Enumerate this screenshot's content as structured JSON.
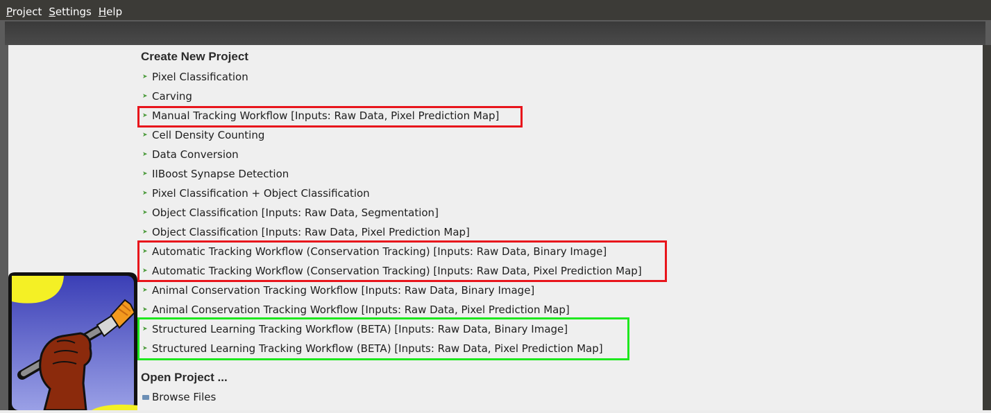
{
  "menu": {
    "items": [
      {
        "mnemonic": "P",
        "rest": "roject"
      },
      {
        "mnemonic": "S",
        "rest": "ettings"
      },
      {
        "mnemonic": "H",
        "rest": "elp"
      }
    ]
  },
  "create": {
    "heading": "Create New Project",
    "workflows": [
      "Pixel Classification",
      "Carving",
      "Manual Tracking Workflow [Inputs: Raw Data, Pixel Prediction Map]",
      "Cell Density Counting",
      "Data Conversion",
      "IIBoost Synapse Detection",
      "Pixel Classification + Object Classification",
      "Object Classification [Inputs: Raw Data, Segmentation]",
      "Object Classification [Inputs: Raw Data, Pixel Prediction Map]",
      "Automatic Tracking Workflow (Conservation Tracking) [Inputs: Raw Data, Binary Image]",
      "Automatic Tracking Workflow (Conservation Tracking) [Inputs: Raw Data, Pixel Prediction Map]",
      "Animal Conservation Tracking Workflow [Inputs: Raw Data, Binary Image]",
      "Animal Conservation Tracking Workflow [Inputs: Raw Data, Pixel Prediction Map]",
      "Structured Learning Tracking Workflow (BETA) [Inputs: Raw Data, Binary Image]",
      "Structured Learning Tracking Workflow (BETA) [Inputs: Raw Data, Pixel Prediction Map]"
    ]
  },
  "open": {
    "heading": "Open Project ...",
    "browse_label": "Browse Files"
  },
  "colors": {
    "highlight_red": "#e8141b",
    "highlight_green": "#1ee81e",
    "menubar": "#3c3b37",
    "arrow_green": "#4a9a3a"
  }
}
